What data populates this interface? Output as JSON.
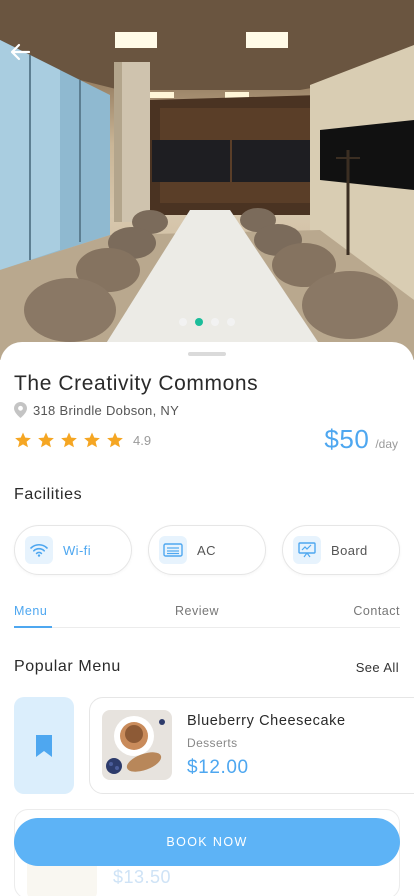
{
  "hero": {
    "image_label": "conference-room-photo",
    "carousel": {
      "count": 4,
      "active_index": 1
    }
  },
  "venue": {
    "name": "The Creativity Commons",
    "address": "318 Brindle Dobson, NY",
    "rating_value": "4.9",
    "stars": 5,
    "price": "$50",
    "price_unit": "/day"
  },
  "facilities": {
    "heading": "Facilities",
    "items": [
      {
        "label": "Wi-fi",
        "icon": "wifi-icon"
      },
      {
        "label": "AC",
        "icon": "ac-icon"
      },
      {
        "label": "Board",
        "icon": "board-icon"
      }
    ]
  },
  "tabs": {
    "items": [
      "Menu",
      "Review",
      "Contact"
    ],
    "active": "Menu"
  },
  "popular_menu": {
    "heading": "Popular Menu",
    "see_all": "See All",
    "items": [
      {
        "name": "Blueberry Cheesecake",
        "category": "Desserts",
        "price": "$12.00"
      },
      {
        "name": "",
        "category": "",
        "price": "$13.50"
      }
    ]
  },
  "cta": {
    "label": "BOOK NOW"
  },
  "colors": {
    "accent": "#4ea7f0",
    "button": "#5db3f6",
    "star": "#f5a623",
    "carousel_active": "#1bbd9a"
  }
}
